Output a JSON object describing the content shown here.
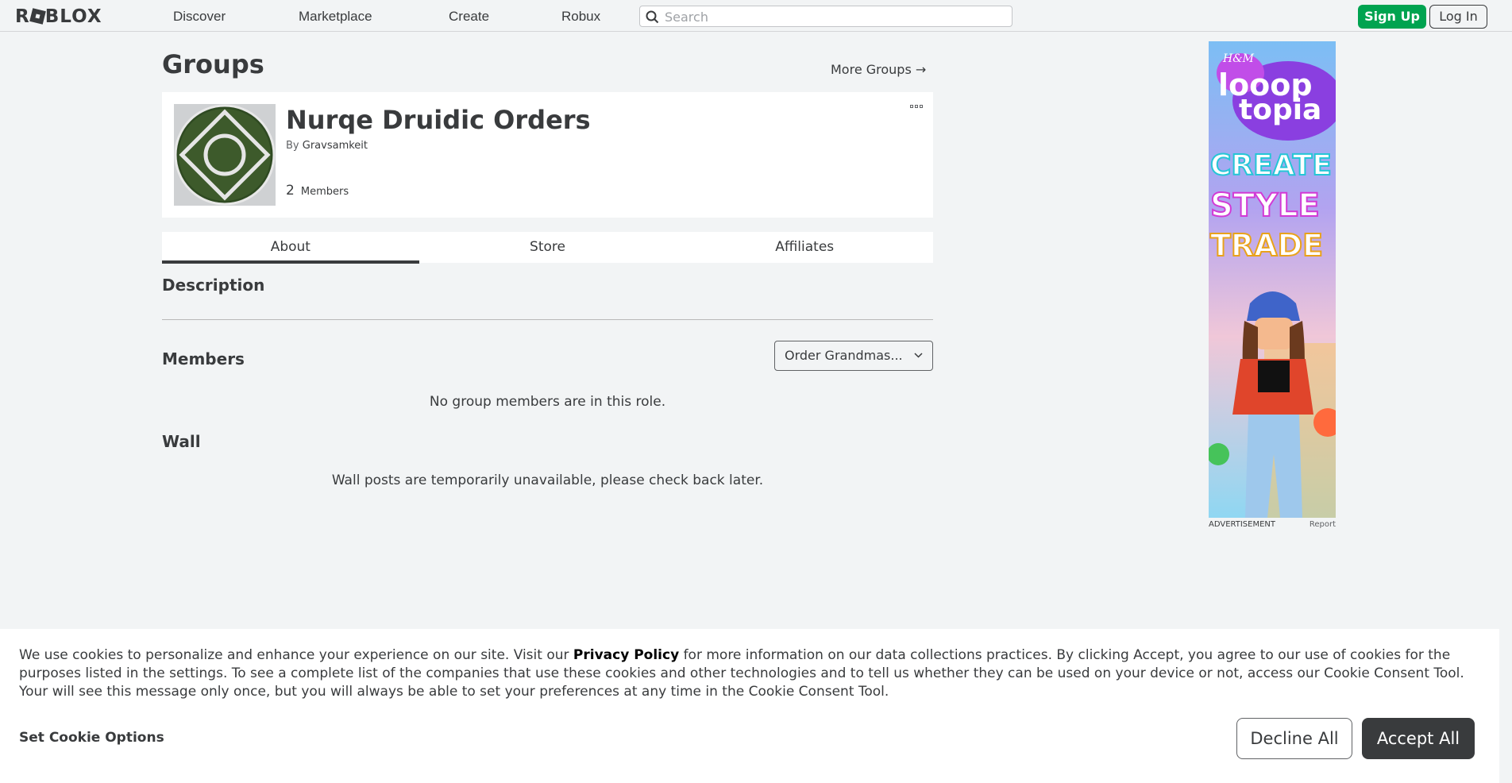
{
  "header": {
    "logo_text": "ROBLOX",
    "nav": [
      "Discover",
      "Marketplace",
      "Create",
      "Robux"
    ],
    "search_placeholder": "Search",
    "signup_label": "Sign Up",
    "login_label": "Log In"
  },
  "page": {
    "title": "Groups",
    "more_groups": "More Groups →"
  },
  "group": {
    "name": "Nurqe Druidic Orders",
    "by_label": "By",
    "owner": "Gravsamkeit",
    "member_count": "2",
    "members_label": "Members"
  },
  "tabs": [
    {
      "label": "About",
      "active": true
    },
    {
      "label": "Store",
      "active": false
    },
    {
      "label": "Affiliates",
      "active": false
    }
  ],
  "about": {
    "description_heading": "Description",
    "members_heading": "Members",
    "role_selected": "Order Grandmas...",
    "members_empty": "No group members are in this role.",
    "wall_heading": "Wall",
    "wall_empty": "Wall posts are temporarily unavailable, please check back later."
  },
  "ad": {
    "brand": "H&M",
    "title_line1": "looop",
    "title_line2": "topia",
    "words": [
      "CREATE",
      "STYLE",
      "TRADE"
    ],
    "label": "ADVERTISEMENT",
    "report": "Report"
  },
  "cookie": {
    "text_before": "We use cookies to personalize and enhance your experience on our site. Visit our ",
    "privacy_link": "Privacy Policy",
    "text_after": " for more information on our data collections practices. By clicking Accept, you agree to our use of cookies for the purposes listed in the settings. To see a complete list of the companies that use these cookies and other technologies and to tell us whether they can be used on your device or not, access our Cookie Consent Tool. Your will see this message only once, but you will always be able to set your preferences at any time in the Cookie Consent Tool.",
    "set_options": "Set Cookie Options",
    "decline": "Decline All",
    "accept": "Accept All"
  },
  "colors": {
    "signup_green": "#00a350",
    "accept_dark": "#393b3d",
    "page_bg": "#f2f4f5"
  }
}
